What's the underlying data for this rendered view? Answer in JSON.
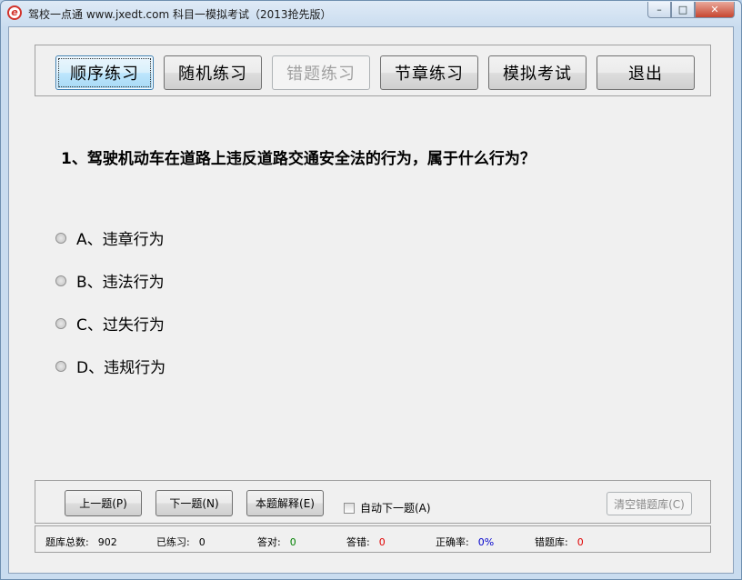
{
  "window": {
    "title": "驾校一点通 www.jxedt.com 科目一模拟考试（2013抢先版）",
    "controls": {
      "minimize": "–",
      "maximize": "□",
      "close": "✕"
    }
  },
  "toolbar": {
    "buttons": [
      "顺序练习",
      "随机练习",
      "错题练习",
      "节章练习",
      "模拟考试",
      "退出"
    ]
  },
  "question": {
    "text": "1、驾驶机动车在道路上违反道路交通安全法的行为，属于什么行为？",
    "options": [
      "A、违章行为",
      "B、违法行为",
      "C、过失行为",
      "D、违规行为"
    ]
  },
  "bottom": {
    "prev": "上一题(P)",
    "next": "下一题(N)",
    "explain": "本题解释(E)",
    "auto_next": "自动下一题(A)",
    "clear": "清空错题库(C)"
  },
  "status": {
    "total_label": "题库总数:",
    "total_value": "902",
    "practiced_label": "已练习:",
    "practiced_value": "0",
    "correct_label": "答对:",
    "correct_value": "0",
    "wrong_label": "答错:",
    "wrong_value": "0",
    "rate_label": "正确率:",
    "rate_value": "0%",
    "wrongbank_label": "错题库:",
    "wrongbank_value": "0"
  },
  "colors": {
    "correct": "#008000",
    "wrong": "#e00000",
    "rate": "#0000cc"
  }
}
